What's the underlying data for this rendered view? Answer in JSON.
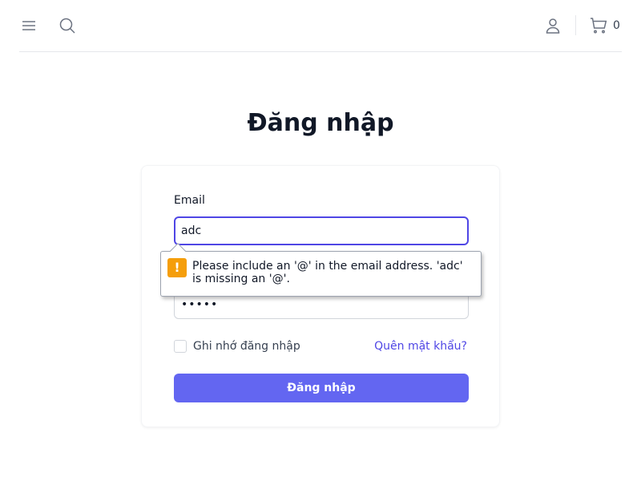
{
  "header": {
    "cart_count": "0"
  },
  "icons": {
    "menu": "menu-icon",
    "search": "search-icon",
    "user": "user-icon",
    "cart": "cart-icon",
    "warning": "warning-icon"
  },
  "page": {
    "title": "Đăng nhập"
  },
  "form": {
    "email_label": "Email",
    "email_value": "adc",
    "password_value": "•••••",
    "remember_label": "Ghi nhớ đăng nhập",
    "forgot_label": "Quên mật khẩu?",
    "submit_label": "Đăng nhập"
  },
  "validation": {
    "message": "Please include an '@' in the email address. 'adc' is missing an '@'."
  },
  "colors": {
    "accent": "#4f46e5",
    "button": "#6366f1",
    "warning": "#f59e0b"
  }
}
